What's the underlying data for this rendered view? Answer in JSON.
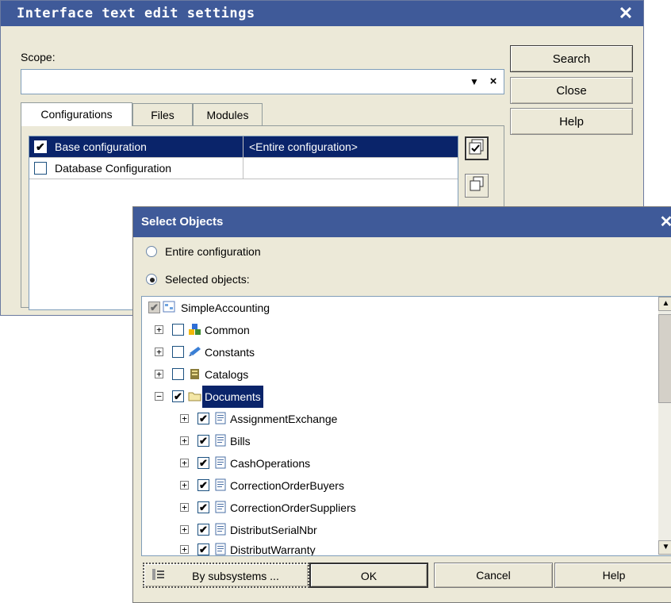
{
  "settings_dialog": {
    "title": "Interface text edit settings",
    "close_glyph": "✕",
    "scope_label": "Scope:",
    "scope_value": "",
    "scope_dropdown_glyph": "▼",
    "scope_clear_glyph": "×",
    "buttons": {
      "search": "Search",
      "close": "Close",
      "help": "Help"
    },
    "tabs": [
      "Configurations",
      "Files",
      "Modules"
    ],
    "configurations": [
      {
        "name": "Base configuration",
        "scope": "<Entire configuration>",
        "checked": true,
        "selected": true
      },
      {
        "name": "Database Configuration",
        "scope": "",
        "checked": false,
        "selected": false
      }
    ]
  },
  "select_objects_dialog": {
    "title": "Select Objects",
    "close_glyph": "✕",
    "radio_entire": "Entire configuration",
    "radio_selected": "Selected objects:",
    "selected_mode": "selected",
    "tree": {
      "root": "SimpleAccounting",
      "top_groups": [
        {
          "label": "Common",
          "icon": "common-icon",
          "checked": false
        },
        {
          "label": "Constants",
          "icon": "constants-icon",
          "checked": false
        },
        {
          "label": "Catalogs",
          "icon": "catalogs-icon",
          "checked": false
        },
        {
          "label": "Documents",
          "icon": "documents-folder-icon",
          "checked": true,
          "expanded": true,
          "selected": true
        }
      ],
      "documents": [
        "AssignmentExchange",
        "Bills",
        "CashOperations",
        "CorrectionOrderBuyers",
        "CorrectionOrderSuppliers",
        "DistributSerialNbr",
        "DistributWarranty"
      ]
    },
    "buttons": {
      "by_subsystems": "By subsystems ...",
      "ok": "OK",
      "cancel": "Cancel",
      "help": "Help"
    }
  }
}
